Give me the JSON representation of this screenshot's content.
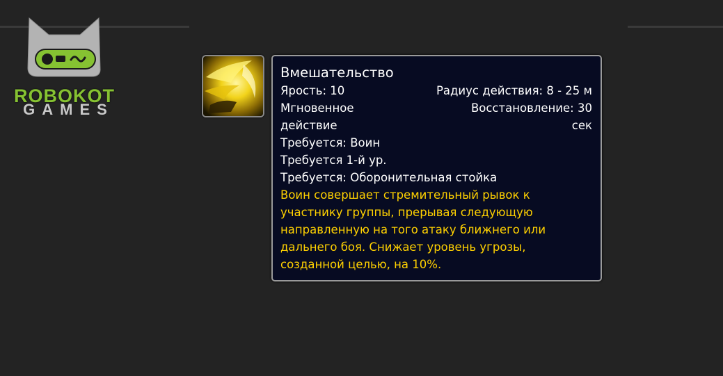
{
  "logo": {
    "line1": "ROBOKOT",
    "line2": "GAMES"
  },
  "spell": {
    "icon": "intervene-icon",
    "name": "Вмешательство",
    "cost": "Ярость: 10",
    "range": "Радиус действия: 8 - 25 м",
    "cast": "Мгновенное действие",
    "cooldown": "Восстановление: 30 сек",
    "req_class": "Требуется: Воин",
    "req_level": "Требуется 1-й ур.",
    "req_stance": "Требуется: Оборонительная стойка",
    "description": "Воин совершает стремительный рывок к участнику группы, прерывая следующую направленную на того атаку ближнего или дальнего боя. Снижает уровень угрозы, созданной целью, на 10%."
  },
  "colors": {
    "background": "#232323",
    "tooltip_bg": "#070b22",
    "tooltip_border": "#9a9a9a",
    "description_text": "#ffd100",
    "logo_green": "#86c232"
  }
}
